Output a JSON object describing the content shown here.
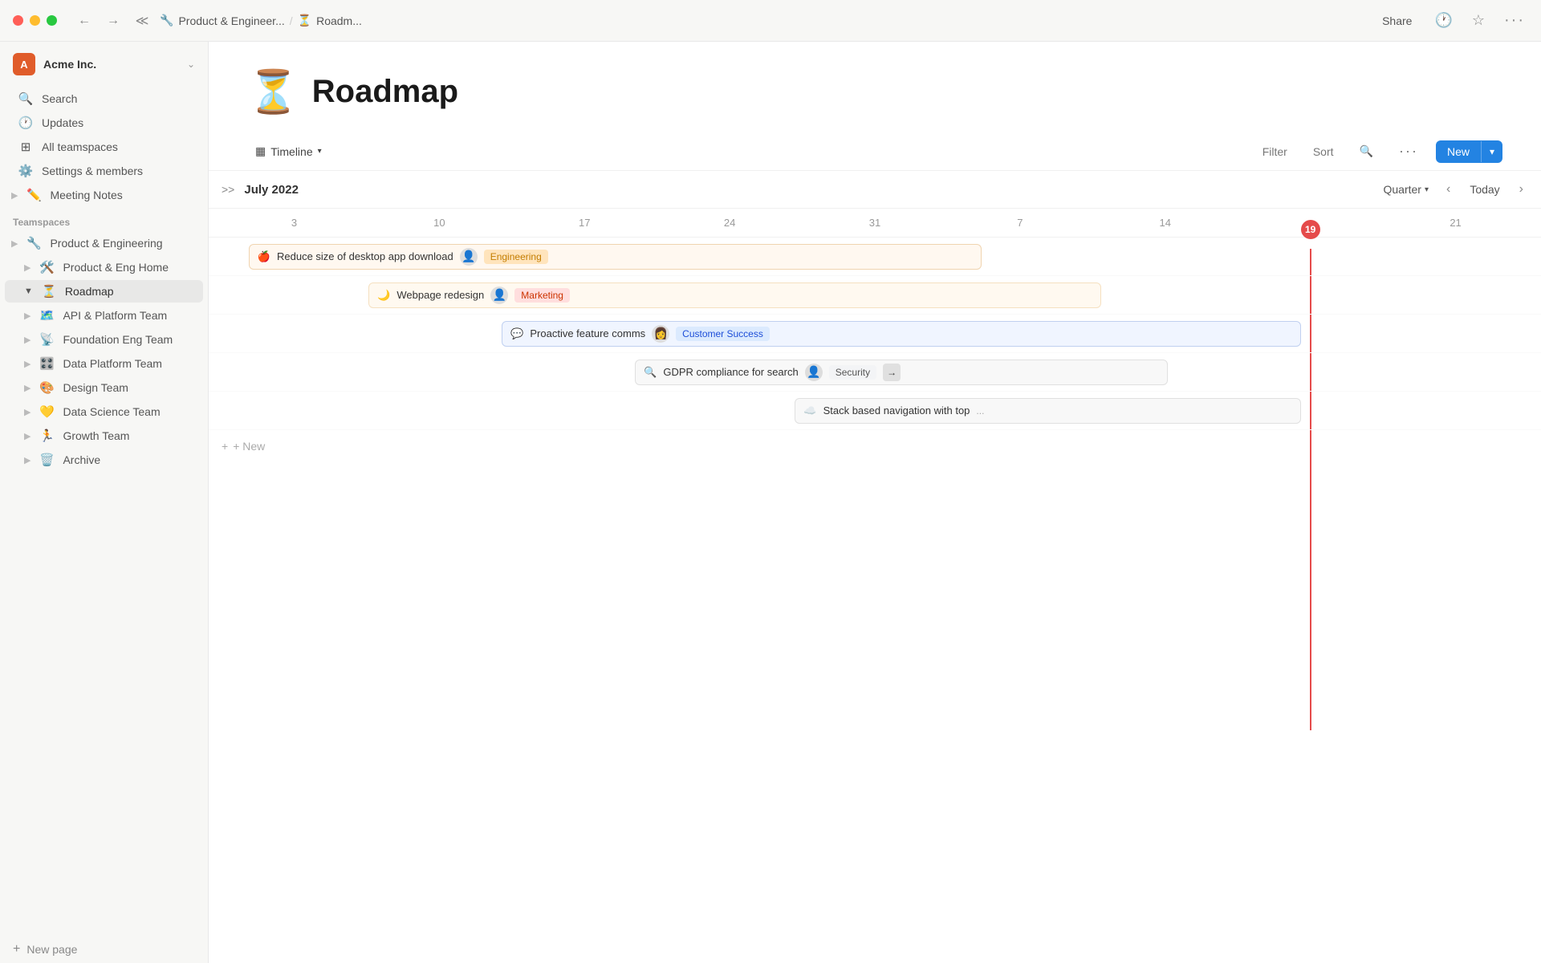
{
  "titlebar": {
    "back_label": "←",
    "forward_label": "→",
    "breadcrumb_parent_icon": "🔧",
    "breadcrumb_parent": "Product & Engineer...",
    "breadcrumb_sep": "/",
    "breadcrumb_current_icon": "⏳",
    "breadcrumb_current": "Roadm...",
    "share_label": "Share",
    "more_label": "···"
  },
  "sidebar": {
    "workspace_initials": "A",
    "workspace_name": "Acme Inc.",
    "items": [
      {
        "icon": "🔍",
        "label": "Search"
      },
      {
        "icon": "🕐",
        "label": "Updates"
      },
      {
        "icon": "⊞",
        "label": "All teamspaces"
      },
      {
        "icon": "⚙️",
        "label": "Settings & members"
      },
      {
        "icon": "✏️",
        "label": "Meeting Notes"
      }
    ],
    "teamspaces_label": "Teamspaces",
    "teamspace_items": [
      {
        "icon": "🔧",
        "label": "Product & Engineering"
      },
      {
        "icon": "🛠️",
        "label": "Product & Eng Home"
      },
      {
        "icon": "⏳",
        "label": "Roadmap",
        "active": true
      },
      {
        "icon": "🗺️",
        "label": "API & Platform Team"
      },
      {
        "icon": "📡",
        "label": "Foundation Eng Team"
      },
      {
        "icon": "🎛️",
        "label": "Data Platform Team"
      },
      {
        "icon": "🎨",
        "label": "Design Team"
      },
      {
        "icon": "💛",
        "label": "Data Science Team"
      },
      {
        "icon": "🏃",
        "label": "Growth Team"
      },
      {
        "icon": "🗑️",
        "label": "Archive"
      }
    ],
    "new_page_label": "New page"
  },
  "page": {
    "emoji": "⏳",
    "title": "Roadmap",
    "view_icon": "▦",
    "view_label": "Timeline",
    "filter_label": "Filter",
    "sort_label": "Sort",
    "new_label": "New"
  },
  "timeline": {
    "expand_icon": ">>",
    "month": "July 2022",
    "quarter_label": "Quarter",
    "today_label": "Today",
    "dates": [
      "3",
      "10",
      "17",
      "24",
      "31",
      "7",
      "14",
      "19",
      "21"
    ],
    "today_date": "19",
    "tasks": [
      {
        "emoji": "🍎",
        "label": "Reduce size of desktop app download",
        "avatar": "👤",
        "tag": "Engineering",
        "tag_class": "tag-engineering",
        "left_pct": 3,
        "width_pct": 56
      },
      {
        "emoji": "🌙",
        "label": "Webpage redesign",
        "avatar": "👤",
        "tag": "Marketing",
        "tag_class": "tag-marketing",
        "left_pct": 12,
        "width_pct": 54
      },
      {
        "emoji": "💬",
        "label": "Proactive feature comms",
        "avatar": "👩",
        "tag": "Customer Success",
        "tag_class": "tag-customer-success",
        "left_pct": 22,
        "width_pct": 60
      },
      {
        "emoji": "🔍",
        "label": "GDPR compliance for search",
        "avatar": "👤",
        "tag": "Security",
        "tag_class": "tag-security",
        "left_pct": 32,
        "width_pct": 36,
        "has_arrow": true
      },
      {
        "emoji": "☁️",
        "label": "Stack based navigation with top",
        "avatar": "",
        "tag": "",
        "tag_class": "",
        "left_pct": 44,
        "width_pct": 35,
        "truncated": true
      }
    ],
    "add_label": "+ New"
  }
}
